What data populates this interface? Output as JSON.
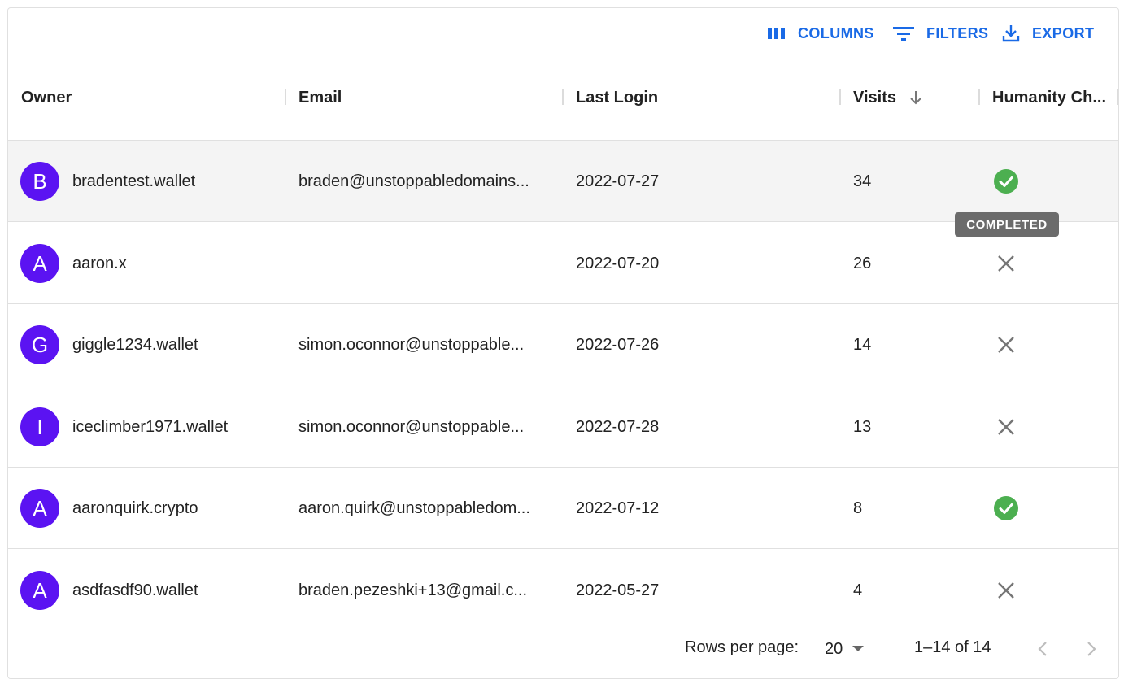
{
  "toolbar": {
    "columns_label": "COLUMNS",
    "filters_label": "FILTERS",
    "export_label": "EXPORT",
    "accent_color": "#1a6ae6"
  },
  "columns": [
    {
      "label": "Owner"
    },
    {
      "label": "Email"
    },
    {
      "label": "Last Login"
    },
    {
      "label": "Visits",
      "sort": "descending",
      "sort_icon": "arrow-down-icon"
    },
    {
      "label": "Humanity Ch..."
    }
  ],
  "rows": [
    {
      "initial": "B",
      "owner": "bradentest.wallet",
      "email": "braden@unstoppabledomains...",
      "last_login": "2022-07-27",
      "visits": "34",
      "humanity_check": "completed",
      "selected": true
    },
    {
      "initial": "A",
      "owner": "aaron.x",
      "email": "",
      "last_login": "2022-07-20",
      "visits": "26",
      "humanity_check": "not-completed"
    },
    {
      "initial": "G",
      "owner": "giggle1234.wallet",
      "email": "simon.oconnor@unstoppable...",
      "last_login": "2022-07-26",
      "visits": "14",
      "humanity_check": "not-completed"
    },
    {
      "initial": "I",
      "owner": "iceclimber1971.wallet",
      "email": "simon.oconnor@unstoppable...",
      "last_login": "2022-07-28",
      "visits": "13",
      "humanity_check": "not-completed"
    },
    {
      "initial": "A",
      "owner": "aaronquirk.crypto",
      "email": "aaron.quirk@unstoppabledom...",
      "last_login": "2022-07-12",
      "visits": "8",
      "humanity_check": "completed"
    },
    {
      "initial": "A",
      "owner": "asdfasdf90.wallet",
      "email": "braden.pezeshki+13@gmail.c...",
      "last_login": "2022-05-27",
      "visits": "4",
      "humanity_check": "not-completed"
    }
  ],
  "tooltip": {
    "text": "COMPLETED"
  },
  "footer": {
    "rows_per_page_label": "Rows per page:",
    "rows_per_page_value": "20",
    "range_text": "1–14 of 14"
  },
  "colors": {
    "avatar": "#5b13f2",
    "check": "#4caf50",
    "cross": "#757575"
  }
}
